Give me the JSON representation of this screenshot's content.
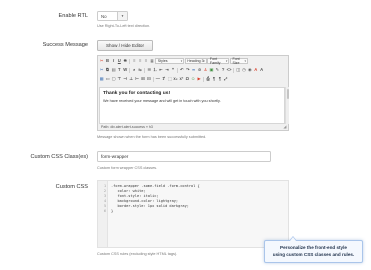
{
  "rtl": {
    "label": "Enable RTL",
    "value": "No",
    "help": "Use Right-To-Left text direction."
  },
  "success": {
    "label": "Success Message",
    "button": "Show / Hide Editor",
    "toolbar": {
      "styles": "Styles",
      "heading": "Heading 3",
      "font_family": "Font Family",
      "font_size": "Font Size"
    },
    "content_heading": "Thank you for contacting us!",
    "content_text": "We have received your message and will get in touch with you shortly.",
    "path": "Path: div.alert.alert-success » h3",
    "help": "Message shown when the form has been successfully submitted."
  },
  "css_class": {
    "label": "Custom CSS Class(es)",
    "value": "form-wrapper",
    "help": "Custom form wrapper CSS classes."
  },
  "custom_css": {
    "label": "Custom CSS",
    "lines": [
      {
        "n": "1",
        "t": ".form-wrapper .some-field .form-control {"
      },
      {
        "n": "2",
        "t": "   color: white;"
      },
      {
        "n": "3",
        "t": "   font-style: italic;"
      },
      {
        "n": "4",
        "t": "   background-color: lightgray;"
      },
      {
        "n": "5",
        "t": "   border-style: 1px solid darkgray;"
      },
      {
        "n": "6",
        "t": "}"
      }
    ],
    "help": "Custom CSS rules (excluding style HTML tags)."
  },
  "callout": {
    "line1": "Personalize the front-end style",
    "line2": "using custom CSS classes and rules."
  }
}
